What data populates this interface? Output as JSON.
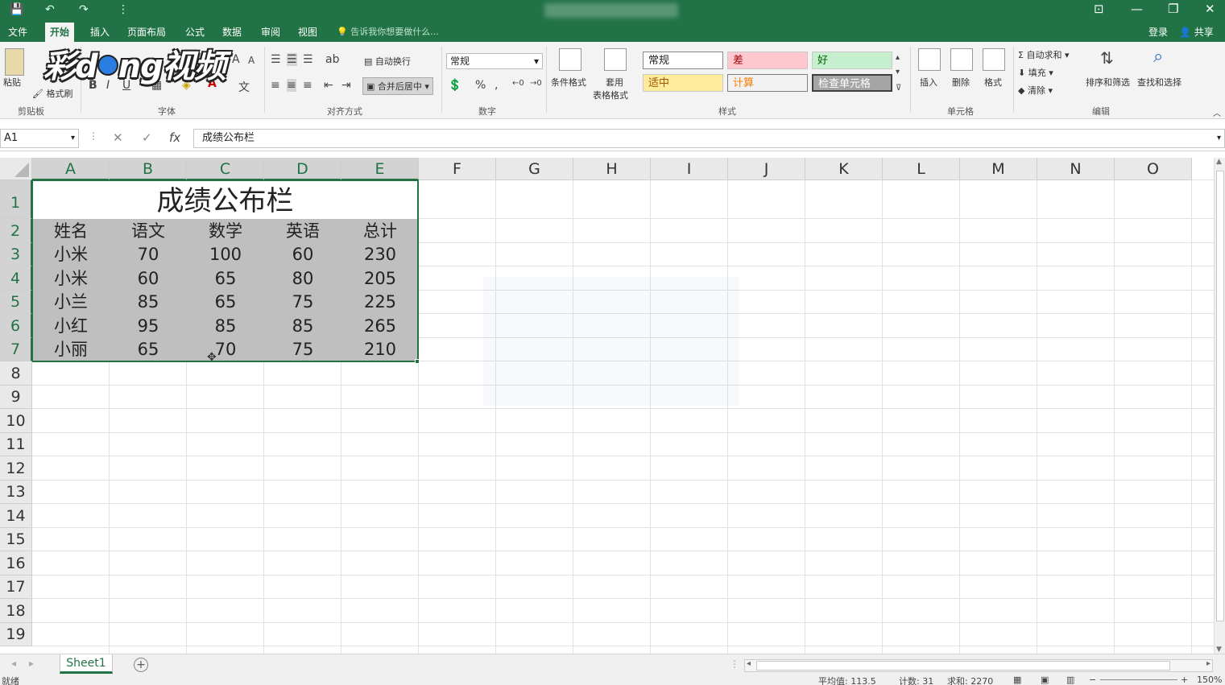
{
  "window": {
    "title": "",
    "controls": [
      "⊡",
      "—",
      "❐",
      "✕"
    ]
  },
  "quick_access": [
    "💾",
    "↶",
    "↷",
    "⋮"
  ],
  "menu": {
    "tabs": [
      "文件",
      "开始",
      "插入",
      "页面布局",
      "公式",
      "数据",
      "审阅",
      "视图"
    ],
    "active_index": 1,
    "tellme": "告诉我你想要做什么...",
    "login": "登录",
    "share": "共享"
  },
  "logo_text": {
    "a": "彩d",
    "b": "ng视频"
  },
  "ribbon": {
    "clipboard": {
      "paste": "粘贴",
      "format_painter": "格式刷",
      "label": "剪贴板"
    },
    "font": {
      "bold": "B",
      "italic": "I",
      "underline": "U",
      "label": "字体"
    },
    "align": {
      "wrap": "自动换行",
      "merge": "合并后居中",
      "label": "对齐方式"
    },
    "number": {
      "format": "常规",
      "percent": "%",
      "comma": ",",
      "label": "数字"
    },
    "styles": {
      "cond_format": "条件格式",
      "table_format_1": "套用",
      "table_format_2": "表格格式",
      "cells": [
        "常规",
        "差",
        "好",
        "适中",
        "计算",
        "检查单元格"
      ],
      "label": "样式"
    },
    "cells": {
      "insert": "插入",
      "delete": "删除",
      "format": "格式",
      "label": "单元格"
    },
    "editing": {
      "autosum": "自动求和",
      "fill": "填充",
      "clear": "清除",
      "sort": "排序和筛选",
      "find": "查找和选择",
      "label": "编辑"
    }
  },
  "formula_bar": {
    "name_box": "A1",
    "fx": "fx",
    "value": "成绩公布栏"
  },
  "columns": [
    "A",
    "B",
    "C",
    "D",
    "E",
    "F",
    "G",
    "H",
    "I",
    "J",
    "K",
    "L",
    "M",
    "N",
    "O"
  ],
  "rows": [
    "1",
    "2",
    "3",
    "4",
    "5",
    "6",
    "7",
    "8",
    "9",
    "10",
    "11",
    "12",
    "13",
    "14",
    "15",
    "16",
    "17",
    "18",
    "19"
  ],
  "table": {
    "title": "成绩公布栏",
    "headers": [
      "姓名",
      "语文",
      "数学",
      "英语",
      "总计"
    ],
    "data": [
      [
        "小米",
        "70",
        "100",
        "60",
        "230"
      ],
      [
        "小米",
        "60",
        "65",
        "80",
        "205"
      ],
      [
        "小兰",
        "85",
        "65",
        "75",
        "225"
      ],
      [
        "小红",
        "95",
        "85",
        "85",
        "265"
      ],
      [
        "小丽",
        "65",
        "70",
        "75",
        "210"
      ]
    ]
  },
  "sheet_tabs": [
    "Sheet1"
  ],
  "status": {
    "ready": "就绪",
    "average": "平均值: 113.5",
    "count": "计数: 31",
    "sum": "求和: 2270",
    "zoom": "150%"
  },
  "colors": {
    "accent": "#217346",
    "selection": "#bfbfbf",
    "bad": "#ffc7ce",
    "good": "#c6efce",
    "neutral": "#ffeb9c"
  }
}
